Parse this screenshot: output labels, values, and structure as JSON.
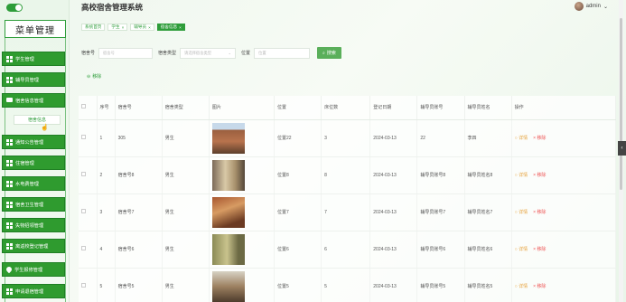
{
  "app_title": "高校宿舍管理系统",
  "user": {
    "name": "admin"
  },
  "sidebar": {
    "menu_title": "菜单管理",
    "items": [
      {
        "label": "学生管理",
        "icon": "grid-icon"
      },
      {
        "label": "辅导员管理",
        "icon": "grid-icon"
      },
      {
        "label": "宿舍信息管理",
        "icon": "chat-icon"
      },
      {
        "label": "通知公告管理",
        "icon": "grid-icon"
      },
      {
        "label": "住宿管理",
        "icon": "grid-icon"
      },
      {
        "label": "水电费管理",
        "icon": "grid-icon"
      },
      {
        "label": "宿舍卫生管理",
        "icon": "grid-icon"
      },
      {
        "label": "失物招领管理",
        "icon": "grid-icon"
      },
      {
        "label": "离返校登记管理",
        "icon": "grid-icon"
      },
      {
        "label": "学生报修管理",
        "icon": "pin-icon"
      },
      {
        "label": "申请退宿管理",
        "icon": "grid-icon"
      }
    ],
    "sub_item": "宿舍信息"
  },
  "tags": [
    {
      "label": "系统首页",
      "closable": false,
      "active": false
    },
    {
      "label": "学生",
      "closable": true,
      "active": false
    },
    {
      "label": "辅导员",
      "closable": true,
      "active": false
    },
    {
      "label": "宿舍信息",
      "closable": true,
      "active": true
    }
  ],
  "search": {
    "room_label": "宿舍号",
    "room_placeholder": "宿舍号",
    "type_label": "宿舍类型",
    "type_placeholder": "请选择宿舍类型",
    "location_label": "位置",
    "location_placeholder": "位置",
    "search_button": "搜索"
  },
  "delete_button": "移除",
  "table": {
    "columns": [
      "",
      "序号",
      "宿舍号",
      "宿舍类型",
      "图片",
      "位置",
      "床位数",
      "登记日期",
      "辅导员账号",
      "辅导员姓名",
      "操作"
    ],
    "rows": [
      {
        "index": "1",
        "room": "305",
        "type": "男生",
        "location": "位置22",
        "beds": "3",
        "date": "2024-03-13",
        "counselor_account": "22",
        "counselor_name": "李四"
      },
      {
        "index": "2",
        "room": "宿舍号8",
        "type": "男生",
        "location": "位置8",
        "beds": "8",
        "date": "2024-03-13",
        "counselor_account": "辅导员账号8",
        "counselor_name": "辅导员姓名8"
      },
      {
        "index": "3",
        "room": "宿舍号7",
        "type": "男生",
        "location": "位置7",
        "beds": "7",
        "date": "2024-03-13",
        "counselor_account": "辅导员账号7",
        "counselor_name": "辅导员姓名7"
      },
      {
        "index": "4",
        "room": "宿舍号6",
        "type": "男生",
        "location": "位置6",
        "beds": "6",
        "date": "2024-03-13",
        "counselor_account": "辅导员账号6",
        "counselor_name": "辅导员姓名6"
      },
      {
        "index": "5",
        "room": "宿舍号5",
        "type": "男生",
        "location": "位置5",
        "beds": "5",
        "date": "2024-03-13",
        "counselor_account": "辅导员账号5",
        "counselor_name": "辅导员姓名5"
      }
    ],
    "op_detail": "详情",
    "op_delete": "移除"
  },
  "colors": {
    "accent": "#2e9d3a",
    "detail": "#e6a23c",
    "danger": "#ee5555"
  }
}
